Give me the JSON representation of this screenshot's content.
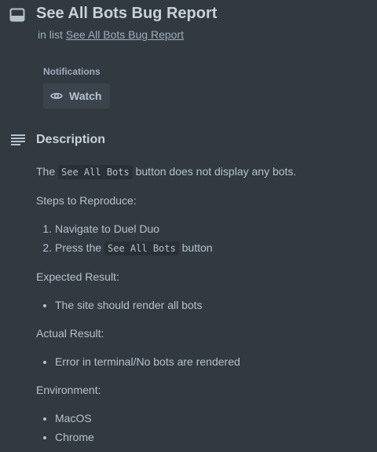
{
  "card": {
    "title": "See All Bots Bug Report",
    "in_list_prefix": "in list",
    "list_name": "See All Bots Bug Report"
  },
  "notifications": {
    "label": "Notifications",
    "watch_label": "Watch"
  },
  "description": {
    "heading": "Description",
    "intro_before": "The",
    "intro_code": "See All Bots",
    "intro_after": "button does not display any bots.",
    "steps_heading": "Steps to Reproduce:",
    "step1": "Navigate to Duel Duo",
    "step2_before": "Press the",
    "step2_code": "See All Bots",
    "step2_after": "button",
    "expected_heading": "Expected Result:",
    "expected_items": [
      "The site should render all bots"
    ],
    "actual_heading": "Actual Result:",
    "actual_items": [
      "Error in terminal/No bots are rendered"
    ],
    "environment_heading": "Environment:",
    "environment_items": [
      "MacOS",
      "Chrome"
    ]
  },
  "colors": {
    "background": "#323940",
    "button_bg": "#3b444c",
    "text": "#b6c2cf",
    "heading": "#c7d1db"
  },
  "icons": {
    "card": "card-icon",
    "watch": "eye-icon",
    "description": "description-lines-icon"
  }
}
